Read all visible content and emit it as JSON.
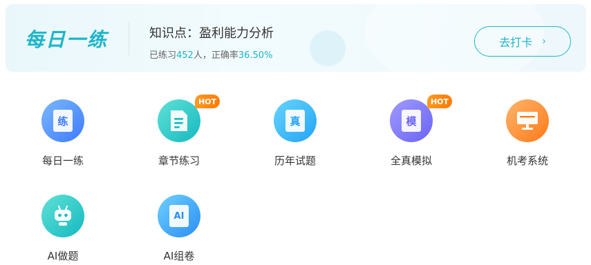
{
  "banner": {
    "brand": "每日一练",
    "title": "知识点：盈利能力分析",
    "stats_prefix": "已练习",
    "practice_count": "452",
    "stats_middle": "人，正确率",
    "accuracy": "36.50%",
    "button_label": "去打卡",
    "button_chevron": "›"
  },
  "tiles": [
    {
      "label": "每日一练",
      "glyph": "练",
      "icon": "daily-practice-icon",
      "hot": ""
    },
    {
      "label": "章节练习",
      "glyph": "",
      "icon": "chapter-doc-icon",
      "hot": "HOT"
    },
    {
      "label": "历年试题",
      "glyph": "真",
      "icon": "past-exams-icon",
      "hot": ""
    },
    {
      "label": "全真模拟",
      "glyph": "模",
      "icon": "mock-exam-icon",
      "hot": "HOT"
    },
    {
      "label": "机考系统",
      "glyph": "",
      "icon": "computer-exam-icon",
      "hot": ""
    },
    {
      "label": "AI做题",
      "glyph": "",
      "icon": "ai-robot-icon",
      "hot": ""
    },
    {
      "label": "AI组卷",
      "glyph": "AI",
      "icon": "ai-paper-icon",
      "hot": ""
    }
  ],
  "colors": {
    "accent": "#1cb5c9",
    "hot_badge": "#ff8a10"
  }
}
